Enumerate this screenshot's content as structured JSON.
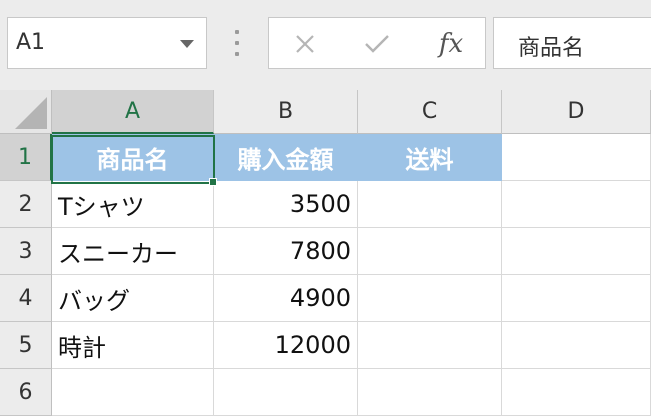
{
  "name_box": {
    "value": "A1"
  },
  "formula_bar": {
    "fx_label": "fx",
    "value": "商品名"
  },
  "columns": [
    "A",
    "B",
    "C",
    "D"
  ],
  "rows": [
    "1",
    "2",
    "3",
    "4",
    "5",
    "6"
  ],
  "cells": {
    "A1": "商品名",
    "B1": "購入金額",
    "C1": "送料",
    "A2": "Tシャツ",
    "B2": "3500",
    "A3": "スニーカー",
    "B3": "7800",
    "A4": "バッグ",
    "B4": "4900",
    "A5": "時計",
    "B5": "12000"
  },
  "colors": {
    "header_fill": "#9dc3e6",
    "header_text": "#ffffff",
    "selection": "#217346"
  },
  "icons": {
    "cancel": "x-icon",
    "enter": "check-icon",
    "function": "fx-icon"
  }
}
